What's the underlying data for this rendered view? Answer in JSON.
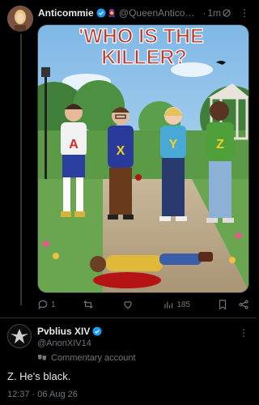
{
  "post": {
    "display_name": "Anticommie",
    "handle": "@QueenAnticom...",
    "separator": "·",
    "time": "1m",
    "emoji": "🧕",
    "image": {
      "title": "'WHO IS THE KILLER?",
      "labels": [
        "A",
        "X",
        "Y",
        "Z"
      ]
    },
    "actions": {
      "replies": "1",
      "retweets": "",
      "likes": "",
      "views": "185"
    }
  },
  "reply": {
    "display_name": "Pvblius XIV",
    "handle": "@AnonXIV14",
    "badge": "Commentary account",
    "text": "Z. He's black.",
    "timestamp": "12:37 · 06 Aug 26"
  },
  "icons": {
    "verified": "verified-badge-icon",
    "grok": "grok-icon",
    "more": "more-icon",
    "reply": "reply-icon",
    "retweet": "retweet-icon",
    "like": "heart-icon",
    "views": "bar-chart-icon",
    "bookmark": "bookmark-icon",
    "share": "share-icon",
    "commentary": "theater-masks-icon"
  },
  "colors": {
    "verified": "#1d9bf0",
    "title_fill": "#c0392b",
    "title_stroke": "#ffffff",
    "muted": "#71767b"
  }
}
